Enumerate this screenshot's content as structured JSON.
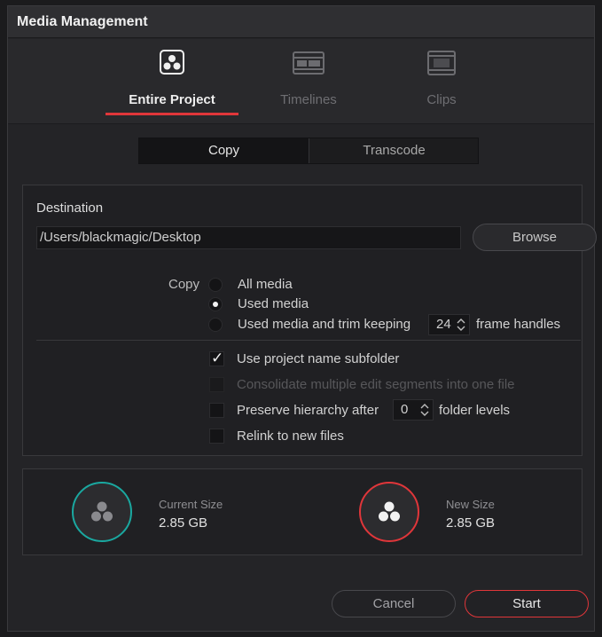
{
  "window": {
    "title": "Media Management"
  },
  "modes": [
    {
      "label": "Entire Project",
      "icon": "resolve-logo-icon",
      "active": true
    },
    {
      "label": "Timelines",
      "icon": "timeline-icon",
      "active": false
    },
    {
      "label": "Clips",
      "icon": "clips-icon",
      "active": false
    }
  ],
  "operation": {
    "copy_label": "Copy",
    "transcode_label": "Transcode",
    "selected": "Copy"
  },
  "destination": {
    "label": "Destination",
    "path": "/Users/blackmagic/Desktop",
    "browse_label": "Browse"
  },
  "copy_options": {
    "label": "Copy",
    "all_media": "All media",
    "used_media": "Used media",
    "trim_prefix": "Used media and trim keeping",
    "frame_handles": "24",
    "trim_suffix": "frame handles",
    "selected": "Used media"
  },
  "checkboxes": {
    "subfolder": {
      "label": "Use project name subfolder",
      "checked": true
    },
    "consolidate": {
      "label": "Consolidate multiple edit segments into one file",
      "checked": false,
      "disabled": true
    },
    "hierarchy_prefix": "Preserve hierarchy after",
    "hierarchy_levels": "0",
    "hierarchy_suffix": "folder levels",
    "relink": {
      "label": "Relink to new files",
      "checked": false
    }
  },
  "sizes": {
    "current_label": "Current Size",
    "current_value": "2.85 GB",
    "new_label": "New Size",
    "new_value": "2.85 GB"
  },
  "footer": {
    "cancel_label": "Cancel",
    "start_label": "Start"
  },
  "colors": {
    "accent_red": "#e0363a",
    "accent_teal": "#1aa8a0",
    "background": "#242427"
  }
}
